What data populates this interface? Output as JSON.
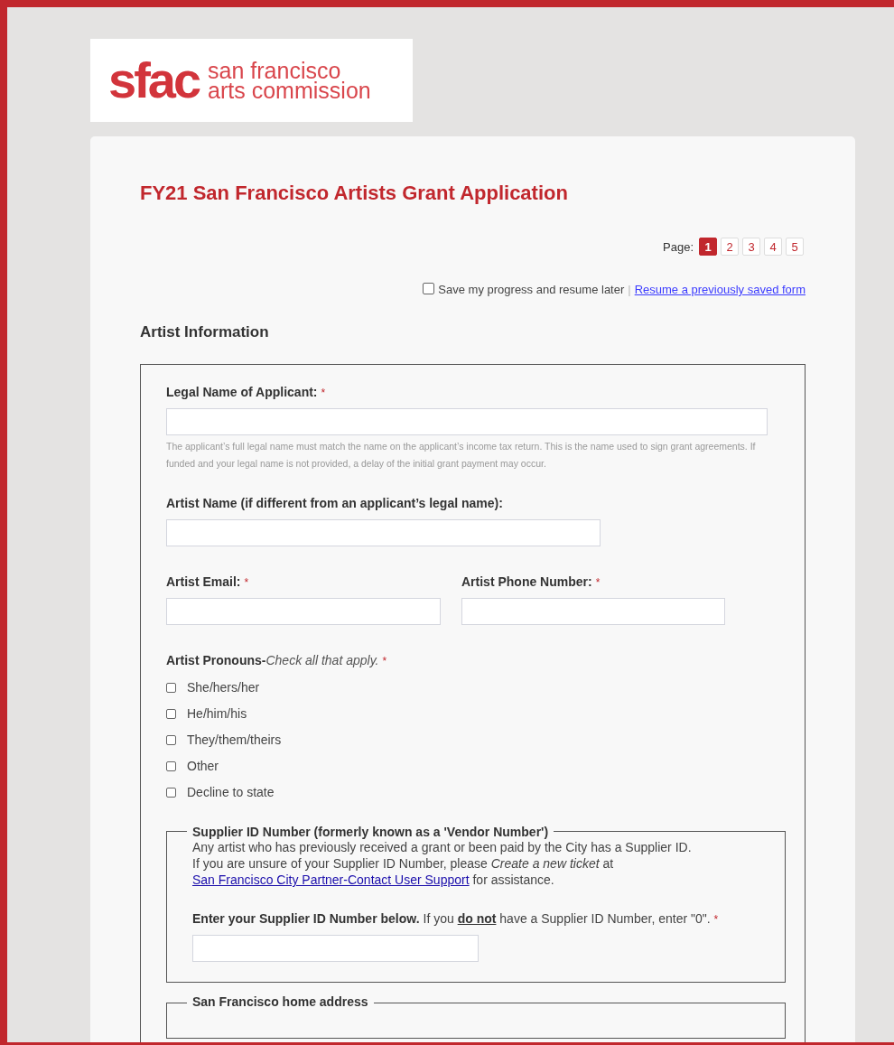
{
  "logo": {
    "mark": "sfac",
    "line1": "san francisco",
    "line2": "arts commission"
  },
  "form_title": "FY21 San Francisco Artists Grant Application",
  "pager": {
    "label": "Page:",
    "pages": [
      {
        "label": "1",
        "selected": true
      },
      {
        "label": "2",
        "selected": false
      },
      {
        "label": "3",
        "selected": false
      },
      {
        "label": "4",
        "selected": false
      },
      {
        "label": "5",
        "selected": false
      }
    ]
  },
  "save_progress": {
    "checked": false,
    "label": "Save my progress and resume later",
    "separator": "|",
    "link": "Resume a previously saved form"
  },
  "section_title": "Artist Information",
  "legal_name": {
    "label": "Legal Name of Applicant:",
    "required_mark": "*",
    "help": "The applicant’s full legal name must match the name on the applicant’s income tax return. This is the name used to sign grant agreements. If funded and your legal name is not provided, a delay of the initial grant payment may occur."
  },
  "artist_name": {
    "label": "Artist Name (if different from an applicant’s legal name):"
  },
  "artist_email": {
    "label": "Artist Email:",
    "required_mark": "*"
  },
  "artist_phone": {
    "label": "Artist Phone Number:",
    "required_mark": "*"
  },
  "pronouns": {
    "label": "Artist Pronouns-",
    "hint": "Check all that apply.",
    "required_mark": "*",
    "options": [
      {
        "label": "She/hers/her",
        "checked": false
      },
      {
        "label": "He/him/his",
        "checked": false
      },
      {
        "label": "They/them/theirs",
        "checked": false
      },
      {
        "label": "Other",
        "checked": false
      },
      {
        "label": "Decline to state",
        "checked": false
      }
    ]
  },
  "supplier": {
    "legend": "Supplier ID Number (formerly known as a 'Vendor Number')",
    "line1": "Any artist who has previously received a grant or been paid by the City has a Supplier ID.",
    "line2": "If you are unsure of your Supplier ID Number, please *Create a new ticket* at",
    "link": "San Francisco City Partner-Contact User Support",
    "line2_end": "for assistance.",
    "field_label": "Enter your Supplier ID Number below.",
    "field_note": "If you **do not** have a Supplier ID Number, enter \"0\".",
    "required_mark": "*"
  },
  "next_legend": "San Francisco home address"
}
